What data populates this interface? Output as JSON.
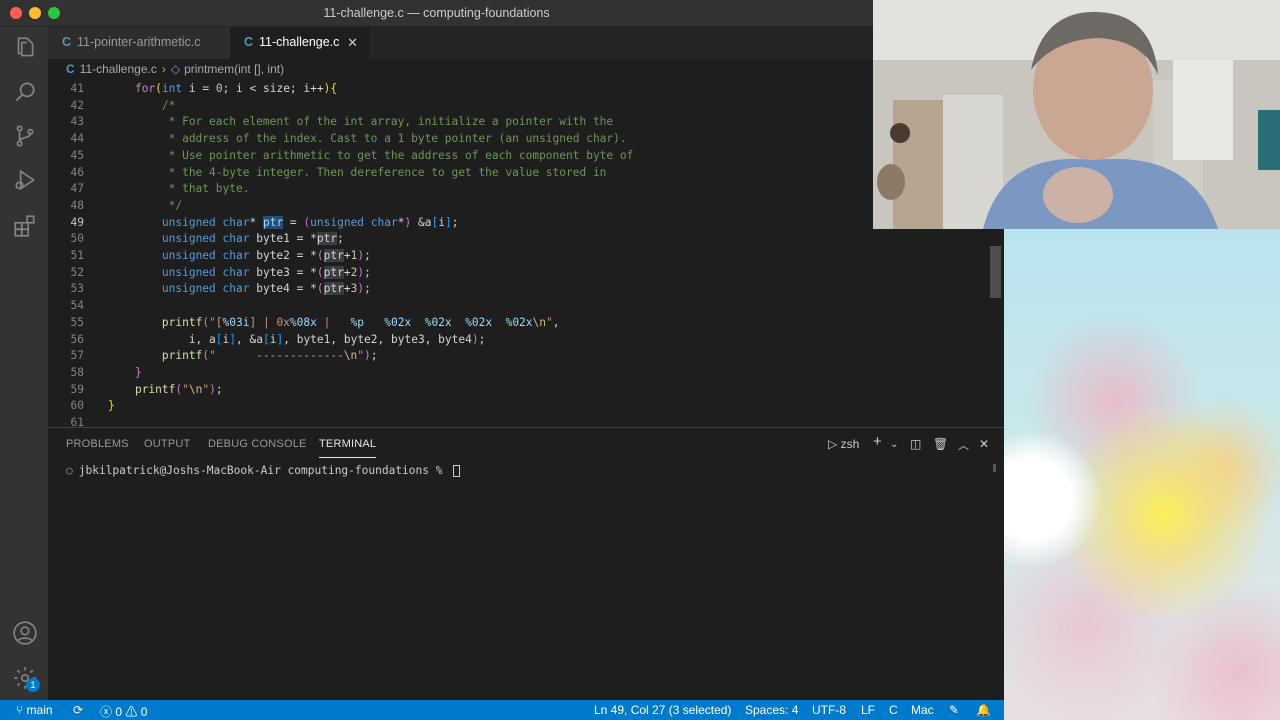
{
  "window": {
    "title": "11-challenge.c — computing-foundations"
  },
  "activity_bar": {
    "items": [
      "explorer-icon",
      "search-icon",
      "source-control-icon",
      "run-debug-icon",
      "extensions-icon"
    ],
    "bottom": [
      "account-icon",
      "manage-gear-icon"
    ],
    "settings_badge": "1"
  },
  "tabs": [
    {
      "icon": "C",
      "label": "11-pointer-arithmetic.c",
      "active": false
    },
    {
      "icon": "C",
      "label": "11-challenge.c",
      "active": true,
      "close": "✕"
    }
  ],
  "breadcrumb": {
    "file_icon": "C",
    "file": "11-challenge.c",
    "separator": "›",
    "symbol": "printmem(int [], int)"
  },
  "editor": {
    "current_line": 49,
    "lines": [
      {
        "n": "41",
        "text": "    for(int i = 0; i < size; i++){"
      },
      {
        "n": "42",
        "text": "        /*"
      },
      {
        "n": "43",
        "text": "         * For each element of the int array, initialize a pointer with the"
      },
      {
        "n": "44",
        "text": "         * address of the index. Cast to a 1 byte pointer (an unsigned char)."
      },
      {
        "n": "45",
        "text": "         * Use pointer arithmetic to get the address of each component byte of"
      },
      {
        "n": "46",
        "text": "         * the 4-byte integer. Then dereference to get the value stored in"
      },
      {
        "n": "47",
        "text": "         * that byte."
      },
      {
        "n": "48",
        "text": "         */"
      },
      {
        "n": "49",
        "text": "        unsigned char* ptr = (unsigned char*) &a[i];"
      },
      {
        "n": "50",
        "text": "        unsigned char byte1 = *ptr;"
      },
      {
        "n": "51",
        "text": "        unsigned char byte2 = *(ptr+1);"
      },
      {
        "n": "52",
        "text": "        unsigned char byte3 = *(ptr+2);"
      },
      {
        "n": "53",
        "text": "        unsigned char byte4 = *(ptr+3);"
      },
      {
        "n": "54",
        "text": ""
      },
      {
        "n": "55",
        "text": "        printf(\"[%03i] | 0x%08x |   %p   %02x  %02x  %02x  %02x\\n\","
      },
      {
        "n": "56",
        "text": "            i, a[i], &a[i], byte1, byte2, byte3, byte4);"
      },
      {
        "n": "57",
        "text": "        printf(\"      -------------\\n\");"
      },
      {
        "n": "58",
        "text": "    }"
      },
      {
        "n": "59",
        "text": "    printf(\"\\n\");"
      },
      {
        "n": "60",
        "text": "}"
      },
      {
        "n": "61",
        "text": ""
      }
    ]
  },
  "panel": {
    "tabs": [
      "PROBLEMS",
      "OUTPUT",
      "DEBUG CONSOLE",
      "TERMINAL"
    ],
    "active_tab": "TERMINAL",
    "shell": "zsh",
    "terminal_prompt": "jbkilpatrick@Joshs-MacBook-Air computing-foundations % "
  },
  "status_bar": {
    "branch": "main",
    "errors": "0",
    "warnings": "0",
    "cursor": "Ln 49, Col 27 (3 selected)",
    "spaces": "Spaces: 4",
    "encoding": "UTF-8",
    "eol": "LF",
    "language": "C",
    "platform": "Mac"
  },
  "colors": {
    "status_bar": "#007acc",
    "editor_bg": "#1e1e1e",
    "comment": "#6a9955",
    "keyword": "#569cd6"
  }
}
